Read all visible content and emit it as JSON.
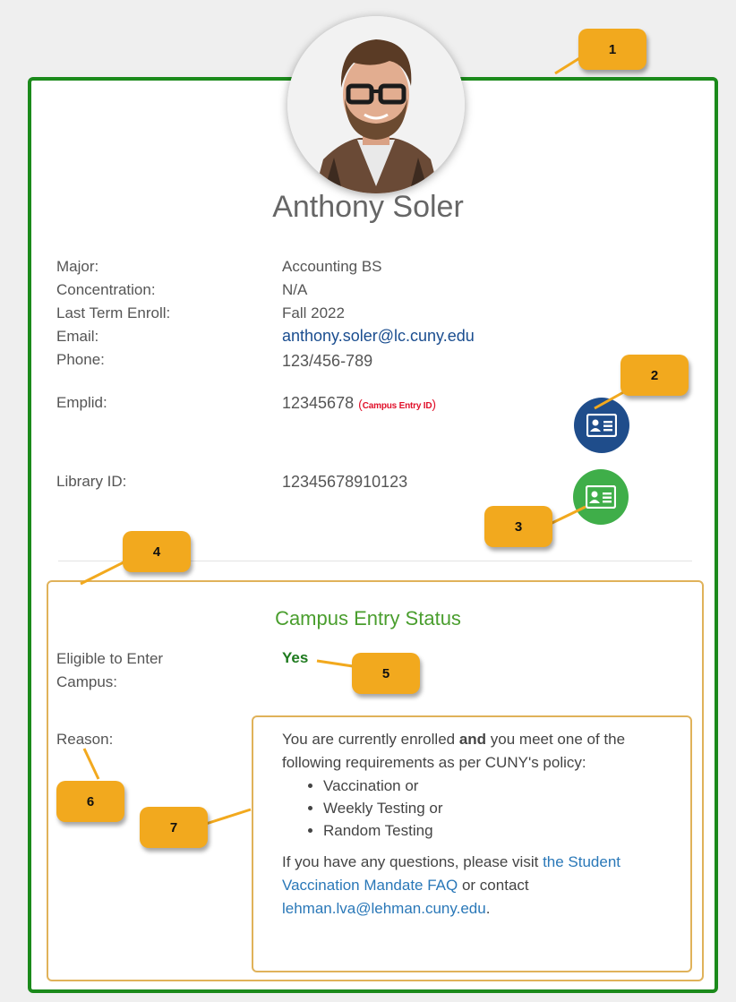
{
  "profile": {
    "name": "Anthony Soler",
    "fields": [
      {
        "label": "Major:",
        "value": "Accounting BS"
      },
      {
        "label": "Concentration:",
        "value": "N/A"
      },
      {
        "label": "Last Term Enroll:",
        "value": "Fall 2022"
      },
      {
        "label": "Email:",
        "value": "anthony.soler@lc.cuny.edu"
      },
      {
        "label": "Phone:",
        "value": "123/456-789"
      },
      {
        "label": "Emplid:",
        "value": "12345678"
      },
      {
        "label": "Library ID:",
        "value": "12345678910123"
      }
    ],
    "emplid_note_open": "(",
    "emplid_note": "Campus Entry ID",
    "emplid_note_close": ")"
  },
  "campus_entry": {
    "title": "Campus Entry Status",
    "eligible_label_line1": "Eligible to Enter",
    "eligible_label_line2": "Campus:",
    "eligible_value": "Yes",
    "reason_label": "Reason:",
    "reason_part1": "You are currently enrolled ",
    "reason_bold": "and",
    "reason_part2": " you meet one of the following requirements as per CUNY's policy:",
    "requirements": [
      "Vaccination or",
      "Weekly Testing or",
      "Random Testing"
    ],
    "questions_pre": "If you have any questions, please visit ",
    "faq_link": "the Student Vaccination Mandate FAQ",
    "questions_mid": " or contact ",
    "contact_email": "lehman.lva@lehman.cuny.edu",
    "questions_end": "."
  },
  "callouts": [
    "1",
    "2",
    "3",
    "4",
    "5",
    "6",
    "7"
  ],
  "colors": {
    "card_border": "#1b8a1b",
    "callout": "#f2a91e",
    "id_button_blue": "#1f4d8b",
    "id_button_green": "#3fae49",
    "status_title": "#4a9e2e",
    "eligible_yes": "#1e7a1e",
    "box_border": "#e0b25a",
    "link": "#2a78b8"
  },
  "icons": {
    "campus_id_button": "id-card-icon",
    "library_id_button": "id-card-icon",
    "avatar": "profile-photo"
  }
}
